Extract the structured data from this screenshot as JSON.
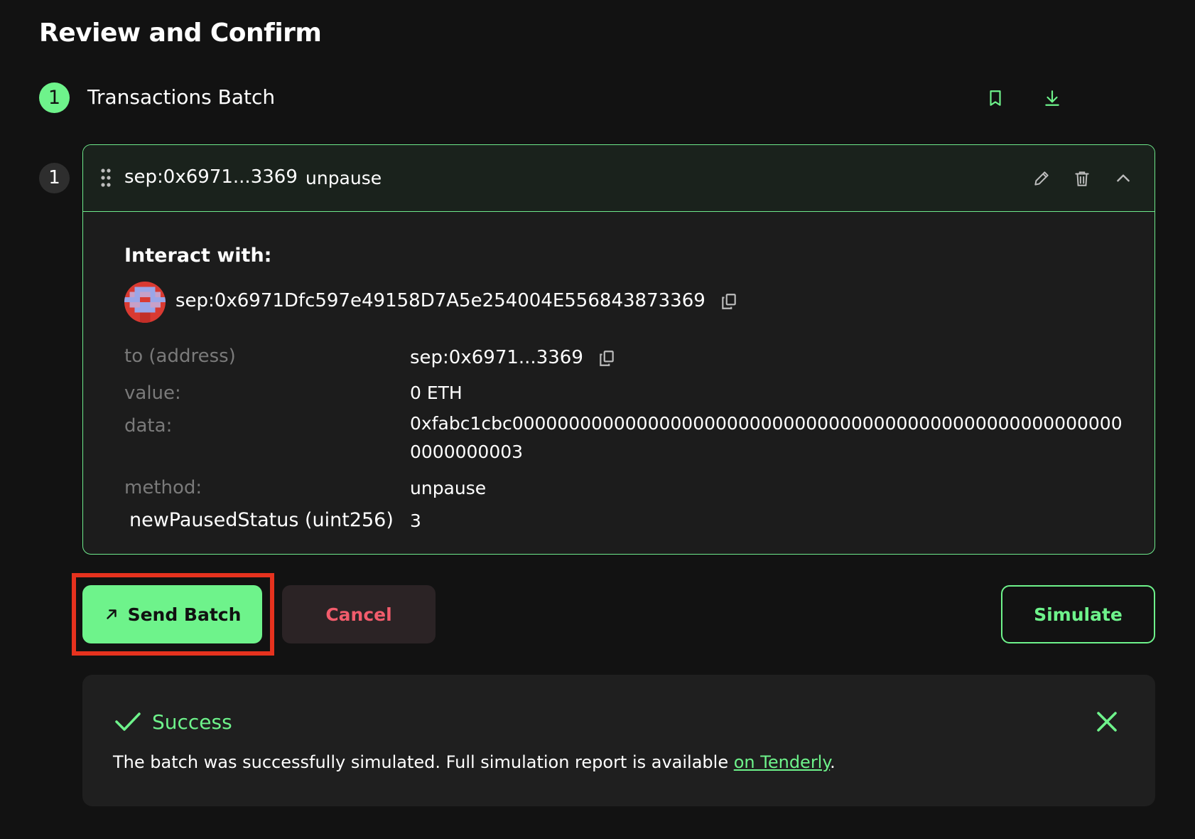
{
  "page": {
    "title": "Review and Confirm"
  },
  "step": {
    "number": "1",
    "label": "Transactions Batch"
  },
  "transaction": {
    "index": "1",
    "address_short": "sep:0x6971...3369",
    "method": "unpause",
    "interact_label": "Interact with:",
    "interact_address": "sep:0x6971Dfc597e49158D7A5e254004E556843873369",
    "fields": {
      "to_label": "to (address)",
      "to_value": "sep:0x6971...3369",
      "value_label": "value:",
      "value_value": "0 ETH",
      "data_label": "data:",
      "data_value": "0xfabc1cbc0000000000000000000000000000000000000000000000000000000000000003",
      "method_label": "method:",
      "method_value": "unpause",
      "param_label": "newPausedStatus (uint256)",
      "param_value": "3"
    }
  },
  "actions": {
    "send_label": "Send Batch",
    "cancel_label": "Cancel",
    "simulate_label": "Simulate"
  },
  "alert": {
    "title": "Success",
    "message": "The batch was successfully simulated. Full simulation report is available ",
    "link_text": "on Tenderly",
    "suffix": "."
  },
  "colors": {
    "accent": "#6ef38b",
    "danger": "#f25c6c",
    "background": "#121212",
    "card": "#1c1c1c",
    "highlight": "#e6321e"
  },
  "icons": {
    "header": [
      "bookmark-icon",
      "download-icon"
    ],
    "tx_header": [
      "drag-handle-icon",
      "pencil-icon",
      "trash-icon",
      "chevron-up-icon"
    ],
    "misc": [
      "copy-icon",
      "arrow-up-right-icon",
      "checkmark-icon",
      "close-icon"
    ]
  }
}
